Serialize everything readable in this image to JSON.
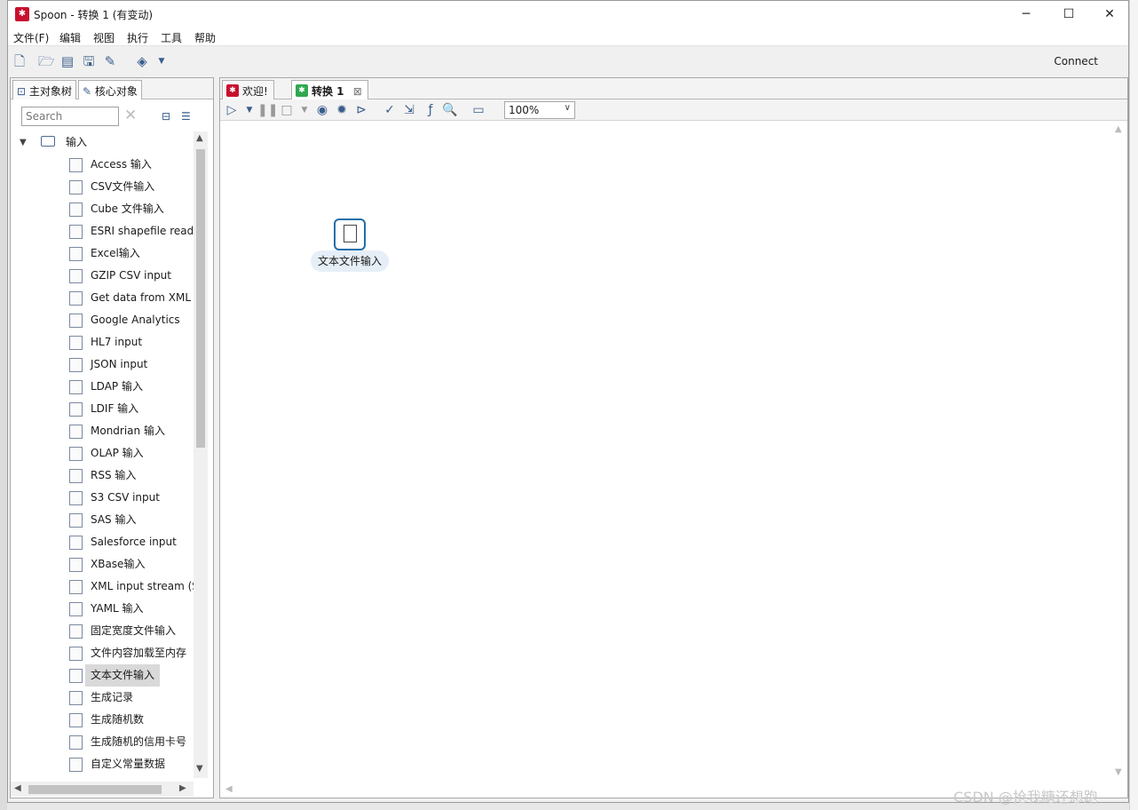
{
  "window": {
    "title": "Spoon - 转换 1 (有变动)",
    "icon": "spoon-app-icon",
    "controls": [
      "─",
      "☐",
      "✕"
    ]
  },
  "menu": [
    "文件(F)",
    "编辑",
    "视图",
    "执行",
    "工具",
    "帮助"
  ],
  "toolbar": {
    "connect_label": "Connect"
  },
  "left_panel": {
    "tabs": [
      "主对象树",
      "核心对象"
    ],
    "search_placeholder": "Search",
    "tree_root": "输入",
    "tree_items": [
      "Access 输入",
      "CSV文件输入",
      "Cube 文件输入",
      "ESRI shapefile reade",
      "Excel输入",
      "GZIP CSV input",
      "Get data from XML",
      "Google Analytics",
      "HL7 input",
      "JSON input",
      "LDAP 输入",
      "LDIF 输入",
      "Mondrian 输入",
      "OLAP 输入",
      "RSS 输入",
      "S3 CSV input",
      "SAS 输入",
      "Salesforce input",
      "XBase输入",
      "XML input stream (S",
      "YAML 输入",
      "固定宽度文件输入",
      "文件内容加载至内存",
      "文本文件输入",
      "生成记录",
      "生成随机数",
      "生成随机的信用卡号",
      "自定义常量数据"
    ],
    "selected_item": "文本文件输入"
  },
  "editor": {
    "tabs": [
      {
        "label": "欢迎!",
        "icon": "spoon-app-icon"
      },
      {
        "label": "转换 1",
        "icon": "transformation-icon",
        "close": "⊠"
      }
    ],
    "zoom": "100%",
    "step": {
      "label": "文本文件输入",
      "icon": "text-file-input-icon"
    }
  },
  "watermark": "CSDN @抢我糖还想跑"
}
